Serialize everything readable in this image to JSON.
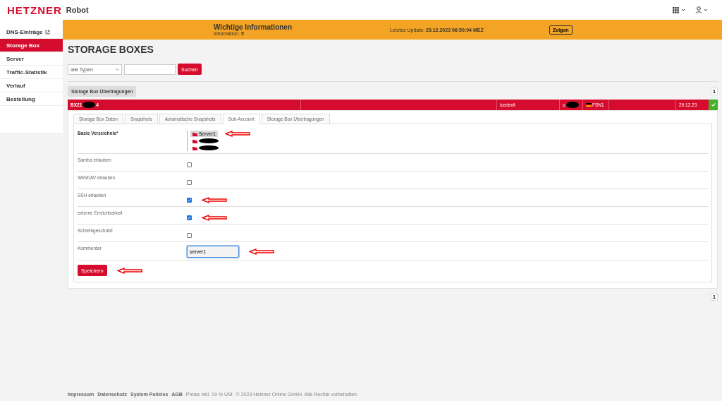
{
  "header": {
    "logo": "HETZNER",
    "product": "Robot"
  },
  "sidebar": {
    "items": [
      {
        "label": "DNS-Einträge",
        "selected": false,
        "external": true
      },
      {
        "label": "Storage Box",
        "selected": true,
        "external": false
      },
      {
        "label": "Server",
        "selected": false,
        "external": false
      },
      {
        "label": "Traffic-Statistik",
        "selected": false,
        "external": false
      },
      {
        "label": "Verlauf",
        "selected": false,
        "external": false
      },
      {
        "label": "Bestellung",
        "selected": false,
        "external": false
      }
    ]
  },
  "banner": {
    "title": "Wichtige Informationen",
    "subtitle": "Information: **5**",
    "update": "Letztes Update: **29.12.2023 06:50:04 MEZ**",
    "button": "Zeigen"
  },
  "page_title": "STORAGE BOXES",
  "filter": {
    "type_select": "alle Typen",
    "button": "Suchen"
  },
  "transfers_button": "Storage Box Übertragungen",
  "top_page": "1",
  "storage_box": {
    "cells": [
      {
        "kind": "redacted",
        "before": "BX21",
        "after": "4"
      },
      {
        "kind": "empty"
      },
      {
        "kind": "text",
        "text": "icedevil"
      },
      {
        "kind": "redacted",
        "before": "u"
      },
      {
        "kind": "flag",
        "text": "FSN1"
      },
      {
        "kind": "empty"
      },
      {
        "kind": "text",
        "text": "29.12.23"
      },
      {
        "kind": "status",
        "ok": true
      }
    ]
  },
  "tabs": [
    {
      "label": "Storage Box Daten",
      "selected": false
    },
    {
      "label": "Snapshots",
      "selected": false
    },
    {
      "label": "Automatische Snapshots",
      "selected": false
    },
    {
      "label": "Sub-Account",
      "selected": true
    },
    {
      "label": "Storage Box Übertragungen",
      "selected": false
    }
  ],
  "form": {
    "rows": [
      {
        "kind": "tree",
        "label": "Basis Verzeichnis*",
        "nodes": [
          {
            "kind": "text",
            "label": "Server1",
            "selected": true,
            "annotated": true
          },
          {
            "kind": "redacted",
            "selected": false,
            "annotated": false
          },
          {
            "kind": "redacted",
            "selected": false,
            "annotated": false
          }
        ]
      },
      {
        "kind": "checkbox",
        "label": "Samba erlauben",
        "checked": false,
        "annotated": false
      },
      {
        "kind": "checkbox",
        "label": "WebDAV erlauben",
        "checked": false,
        "annotated": false
      },
      {
        "kind": "checkbox",
        "label": "SSH erlauben",
        "checked": true,
        "annotated": true
      },
      {
        "kind": "checkbox",
        "label": "externe Erreichbarkeit",
        "checked": true,
        "annotated": true
      },
      {
        "kind": "checkbox",
        "label": "Schreibgeschützt",
        "checked": false,
        "annotated": false
      },
      {
        "kind": "input",
        "label": "Kommentar",
        "value": "server1",
        "focused": true,
        "annotated": true
      }
    ],
    "save_button": "Speichern",
    "save_annotated": true
  },
  "bottom_page": "1",
  "footer": {
    "links": [
      "Impressum",
      "Datenschutz",
      "System Policies",
      "AGB"
    ],
    "texts": [
      "Preise inkl. 19 % USt",
      "© 2023 Hetzner Online GmbH. Alle Rechte vorbehalten."
    ]
  }
}
